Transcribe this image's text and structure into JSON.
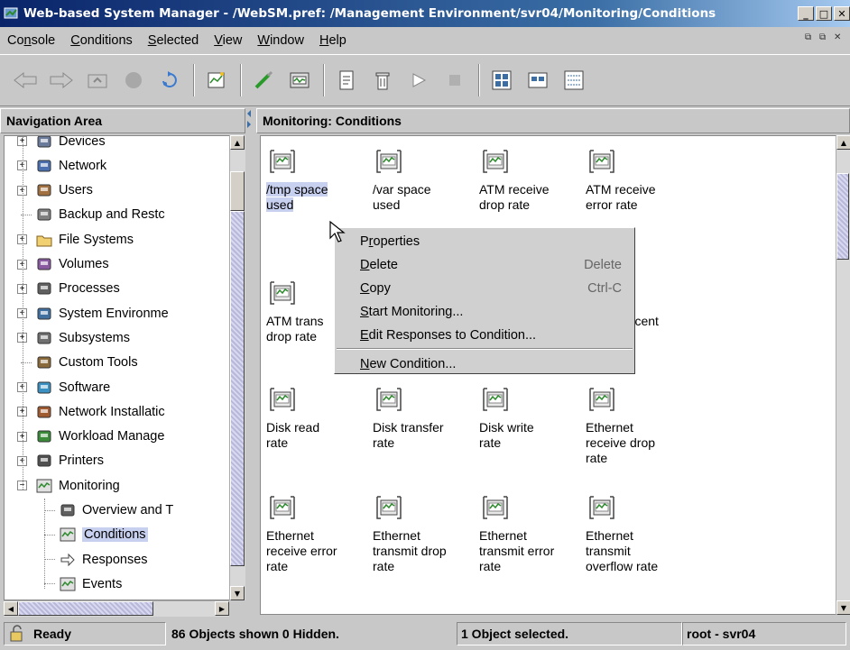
{
  "window": {
    "title": "Web-based System Manager - /WebSM.pref: /Management Environment/svr04/Monitoring/Conditions",
    "controls": [
      "minimize",
      "maximize",
      "close"
    ]
  },
  "menubar": {
    "items": [
      {
        "label": "Console",
        "mnemonic": "n"
      },
      {
        "label": "Conditions",
        "mnemonic": "C"
      },
      {
        "label": "Selected",
        "mnemonic": "S"
      },
      {
        "label": "View",
        "mnemonic": "V"
      },
      {
        "label": "Window",
        "mnemonic": "W"
      },
      {
        "label": "Help",
        "mnemonic": "H"
      }
    ]
  },
  "toolbar": {
    "buttons": [
      "back-icon",
      "forward-icon",
      "up-level-icon",
      "stop-icon",
      "refresh-icon",
      "find-icon",
      "new-condition-icon",
      "monitor-icon",
      "properties-icon",
      "delete-icon",
      "start-icon",
      "stop-monitoring-icon",
      "large-icons-view-icon",
      "small-icons-view-icon",
      "details-view-icon"
    ]
  },
  "navigation": {
    "header": "Navigation Area",
    "items": [
      {
        "label": "Devices",
        "icon": "devices-icon",
        "expandable": true
      },
      {
        "label": "Network",
        "icon": "network-icon",
        "expandable": true
      },
      {
        "label": "Users",
        "icon": "users-icon",
        "expandable": true
      },
      {
        "label": "Backup and Restc",
        "icon": "backup-icon",
        "expandable": false
      },
      {
        "label": "File Systems",
        "icon": "folder-icon",
        "expandable": true
      },
      {
        "label": "Volumes",
        "icon": "volumes-icon",
        "expandable": true
      },
      {
        "label": "Processes",
        "icon": "processes-icon",
        "expandable": true
      },
      {
        "label": "System Environme",
        "icon": "system-environment-icon",
        "expandable": true
      },
      {
        "label": "Subsystems",
        "icon": "subsystems-icon",
        "expandable": true
      },
      {
        "label": "Custom Tools",
        "icon": "custom-tools-icon",
        "expandable": false
      },
      {
        "label": "Software",
        "icon": "software-icon",
        "expandable": true
      },
      {
        "label": "Network Installatic",
        "icon": "network-installation-icon",
        "expandable": true
      },
      {
        "label": "Workload Manage",
        "icon": "workload-manager-icon",
        "expandable": true
      },
      {
        "label": "Printers",
        "icon": "printers-icon",
        "expandable": true
      },
      {
        "label": "Monitoring",
        "icon": "monitoring-icon",
        "expandable": true,
        "expanded": true
      },
      {
        "label": "Overview and T",
        "icon": "overview-icon",
        "child": true
      },
      {
        "label": "Conditions",
        "icon": "conditions-icon",
        "child": true,
        "selected": true
      },
      {
        "label": "Responses",
        "icon": "responses-icon",
        "child": true
      },
      {
        "label": "Events",
        "icon": "events-icon",
        "child": true
      }
    ]
  },
  "main": {
    "header": "Monitoring: Conditions",
    "conditions": [
      {
        "lines": [
          "/tmp space",
          "used"
        ],
        "selected": true
      },
      {
        "lines": [
          "/var space",
          "used"
        ]
      },
      {
        "lines": [
          "ATM receive",
          "drop rate"
        ]
      },
      {
        "lines": [
          "ATM receive",
          "error rate"
        ]
      },
      {
        "lines": [
          "ATM trans",
          "drop rate"
        ]
      },
      {
        "lines": [
          "ercent"
        ]
      },
      {
        "lines": [
          "Disk read",
          "rate"
        ]
      },
      {
        "lines": [
          "Disk transfer",
          "rate"
        ]
      },
      {
        "lines": [
          "Disk write",
          "rate"
        ]
      },
      {
        "lines": [
          "Ethernet",
          "receive drop",
          "rate"
        ]
      },
      {
        "lines": [
          "Ethernet",
          "receive error",
          "rate"
        ]
      },
      {
        "lines": [
          "Ethernet",
          "transmit drop",
          "rate"
        ]
      },
      {
        "lines": [
          "Ethernet",
          "transmit error",
          "rate"
        ]
      },
      {
        "lines": [
          "Ethernet",
          "transmit",
          "overflow rate"
        ]
      }
    ]
  },
  "context_menu": {
    "items": [
      {
        "label": "Properties",
        "mnemonic_index": 1,
        "accelerator": ""
      },
      {
        "label": "Delete",
        "mnemonic_index": 0,
        "accelerator": "Delete"
      },
      {
        "label": "Copy",
        "mnemonic_index": 0,
        "accelerator": "Ctrl-C"
      },
      {
        "label": "Start Monitoring...",
        "mnemonic_index": 0,
        "accelerator": ""
      },
      {
        "label": "Edit Responses to Condition...",
        "mnemonic_index": 0,
        "accelerator": ""
      },
      {
        "label": "New Condition...",
        "mnemonic_index": 0,
        "accelerator": ""
      }
    ]
  },
  "statusbar": {
    "ready": "Ready",
    "objects": "86 Objects shown 0 Hidden.",
    "selected": "1 Object selected.",
    "host": "root - svr04"
  }
}
